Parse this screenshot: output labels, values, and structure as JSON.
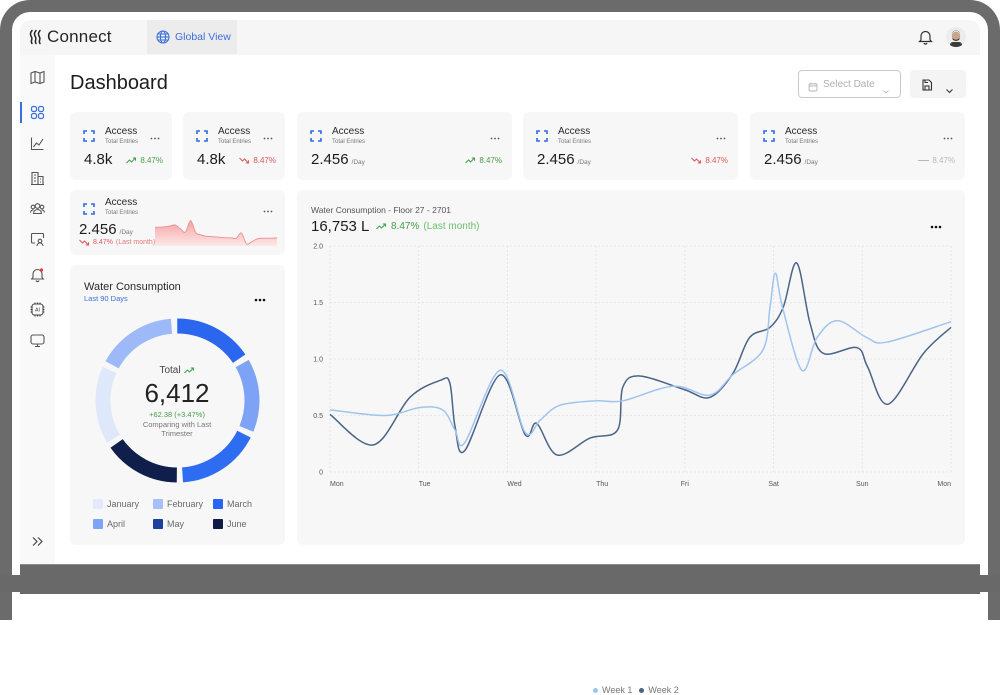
{
  "app": {
    "name": "Connect",
    "nav_tab": "Global View"
  },
  "header": {
    "notification_icon": "bell-icon",
    "avatar": "user-avatar"
  },
  "sidebar": {
    "items": [
      {
        "icon": "map-icon"
      },
      {
        "icon": "dashboard-grid-icon",
        "active": true
      },
      {
        "icon": "analytics-icon"
      },
      {
        "icon": "building-icon"
      },
      {
        "icon": "users-icon"
      },
      {
        "icon": "monitor-user-icon"
      },
      {
        "icon": "alerts-bell-icon",
        "badge": true
      },
      {
        "icon": "ai-chip-icon"
      },
      {
        "icon": "display-icon"
      }
    ],
    "collapse_icon": "double-chevron-right-icon"
  },
  "page": {
    "title": "Dashboard",
    "date_picker": {
      "placeholder": "Select Date"
    },
    "save_menu": {
      "icon": "save-icon"
    }
  },
  "colors": {
    "accent": "#2f6ae0",
    "up": "#43a047",
    "down": "#e05656",
    "flat": "#b8b8b8"
  },
  "kpis": [
    {
      "title": "Access",
      "subtitle": "Total Entries",
      "value": "4.8k",
      "unit": "",
      "trend": "up",
      "change": "8.47%"
    },
    {
      "title": "Access",
      "subtitle": "Total Entries",
      "value": "4.8k",
      "unit": "",
      "trend": "down",
      "change": "8.47%"
    },
    {
      "title": "Access",
      "subtitle": "Total Entries",
      "value": "2.456",
      "unit": "/Day",
      "trend": "up",
      "change": "8.47%"
    },
    {
      "title": "Access",
      "subtitle": "Total Entries",
      "value": "2.456",
      "unit": "/Day",
      "trend": "down",
      "change": "8.47%"
    },
    {
      "title": "Access",
      "subtitle": "Total Entries",
      "value": "2.456",
      "unit": "/Day",
      "trend": "flat",
      "change": "8.47%"
    }
  ],
  "mini_card": {
    "title": "Access",
    "subtitle": "Total Entries",
    "value": "2.456",
    "unit": "/Day",
    "trend": "down",
    "change": "8.47%",
    "period": "(Last month)"
  },
  "donut_card": {
    "title": "Water Consumption",
    "subtitle": "Last 90 Days",
    "center": {
      "label": "Total",
      "value": "6,412",
      "delta": "+62.38 (+3.47%)",
      "caption_line1": "Comparing with Last",
      "caption_line2": "Trimester"
    }
  },
  "line_card": {
    "title": "Water Consumption - Floor 27 - 2701",
    "value": "16,753 L",
    "change": "8.47%",
    "period": "(Last month)"
  },
  "chart_data": [
    {
      "type": "pie",
      "variant": "donut",
      "title": "Water Consumption",
      "subtitle": "Last 90 Days",
      "categories": [
        "January",
        "February",
        "March",
        "April",
        "May",
        "June"
      ],
      "values_pct": [
        16.5,
        17.0,
        16.8,
        15.7,
        17.7,
        16.3
      ],
      "total": "6,412",
      "legend_colors": [
        "#e3eafb",
        "#a6bff8",
        "#2b64f0",
        "#7ea4f6",
        "#1f3f9f",
        "#0f1c45"
      ],
      "segment_colors": [
        "#dfe7fb",
        "#9db9f7",
        "#2a66ee",
        "#7ea3f6",
        "#2e6cf1",
        "#0f1e4a"
      ],
      "legend": "bottom"
    },
    {
      "type": "line",
      "title": "Water Consumption - Floor 27 - 2701",
      "xlabel": "",
      "ylabel": "",
      "x_ticks": [
        "Mon",
        "Tue",
        "Wed",
        "Thu",
        "Fri",
        "Sat",
        "Sun",
        "Mon"
      ],
      "y_ticks": [
        {
          "value": 0,
          "label": "0"
        },
        {
          "value": 0.5,
          "label": "0.5"
        },
        {
          "value": 1,
          "label": "1.0"
        },
        {
          "value": 1.5,
          "label": "1.5"
        },
        {
          "value": 2,
          "label": "2.0"
        }
      ],
      "xlim": [
        0,
        7
      ],
      "ylim": [
        0,
        2
      ],
      "grid": true,
      "legend": "bottom-center",
      "series": [
        {
          "name": "Week 2",
          "color": "#4b6486",
          "points": [
            [
              0,
              0.51
            ],
            [
              0.49,
              0.24
            ],
            [
              0.9,
              0.66
            ],
            [
              1.24,
              0.81
            ],
            [
              1.35,
              0.79
            ],
            [
              1.41,
              0.4
            ],
            [
              1.52,
              0.19
            ],
            [
              1.92,
              0.86
            ],
            [
              2.2,
              0.33
            ],
            [
              2.33,
              0.43
            ],
            [
              2.56,
              0.15
            ],
            [
              2.93,
              0.3
            ],
            [
              3.24,
              0.37
            ],
            [
              3.3,
              0.75
            ],
            [
              3.49,
              0.85
            ],
            [
              3.99,
              0.73
            ],
            [
              4.28,
              0.66
            ],
            [
              4.54,
              0.87
            ],
            [
              4.73,
              1.19
            ],
            [
              4.96,
              1.28
            ],
            [
              5.11,
              1.46
            ],
            [
              5.26,
              1.85
            ],
            [
              5.41,
              1.32
            ],
            [
              5.56,
              1.05
            ],
            [
              5.94,
              1.1
            ],
            [
              6.06,
              0.93
            ],
            [
              6.29,
              0.6
            ],
            [
              6.69,
              1.05
            ],
            [
              7,
              1.28
            ]
          ]
        },
        {
          "name": "Week 1",
          "color": "#9fc5ee",
          "points": [
            [
              0,
              0.55
            ],
            [
              0.62,
              0.5
            ],
            [
              1.01,
              0.57
            ],
            [
              1.27,
              0.55
            ],
            [
              1.41,
              0.37
            ],
            [
              1.52,
              0.26
            ],
            [
              1.92,
              0.9
            ],
            [
              2.2,
              0.35
            ],
            [
              2.37,
              0.46
            ],
            [
              2.59,
              0.59
            ],
            [
              3,
              0.63
            ],
            [
              3.3,
              0.63
            ],
            [
              3.87,
              0.76
            ],
            [
              4.28,
              0.68
            ],
            [
              4.54,
              0.86
            ],
            [
              4.88,
              1.08
            ],
            [
              4.96,
              1.46
            ],
            [
              5.02,
              1.76
            ],
            [
              5.1,
              1.46
            ],
            [
              5.32,
              0.9
            ],
            [
              5.49,
              1.19
            ],
            [
              5.72,
              1.34
            ],
            [
              6.05,
              1.19
            ],
            [
              6.28,
              1.15
            ],
            [
              7,
              1.33
            ]
          ]
        }
      ],
      "legend_order": [
        "Week 1",
        "Week 2"
      ]
    },
    {
      "type": "area",
      "title": "Access sparkline",
      "color": "#ee8f8f",
      "ylim": [
        0,
        1
      ],
      "values": [
        0.46,
        0.46,
        0.47,
        0.49,
        0.51,
        0.42,
        0.34,
        0.62,
        0.33,
        0.27,
        0.24,
        0.23,
        0.22,
        0.21,
        0.2,
        0.2,
        0.19,
        0.32,
        0.05,
        0.1,
        0.17,
        0.19,
        0.19,
        0.19,
        0.2
      ]
    }
  ]
}
